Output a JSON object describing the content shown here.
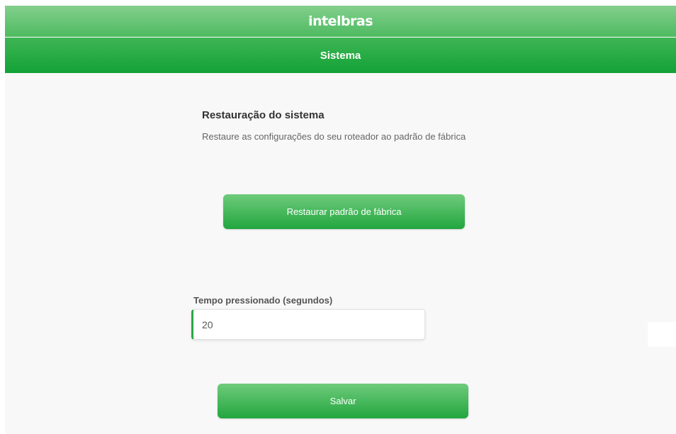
{
  "header": {
    "logo_text": "intelbras",
    "title": "Sistema"
  },
  "restore_section": {
    "title": "Restauração do sistema",
    "description": "Restaure as configurações do seu roteador ao padrão de fábrica",
    "restore_button_label": "Restaurar padrão de fábrica"
  },
  "press_time": {
    "label": "Tempo pressionado (segundos)",
    "value": "20"
  },
  "footer": {
    "save_button_label": "Salvar"
  },
  "colors": {
    "brand_green": "#13a237",
    "light_green": "#83cf8d",
    "panel_bg": "#f8f8f8"
  }
}
